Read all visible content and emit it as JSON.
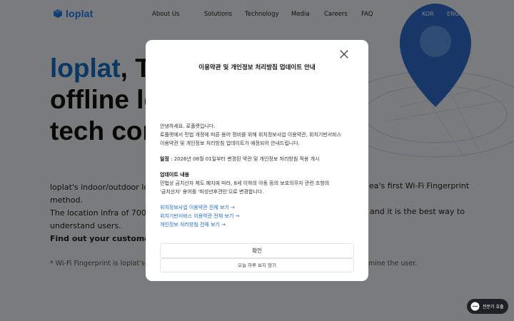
{
  "nav": {
    "logo_text": "loplat",
    "items": [
      "About Us",
      "Solutions",
      "Technology",
      "Media",
      "Careers",
      "FAQ"
    ],
    "lang": [
      "KOR",
      "ENG"
    ]
  },
  "hero": {
    "title_brand": "loplat",
    "title_line1_rest": ", T",
    "title_line2": "offline lo",
    "title_line3": "tech cor",
    "desc_line1_left": "loplat's indoor/outdoor loca",
    "desc_line1_right": "ea's first Wi-Fi Fingerprint",
    "desc_line2": "method.",
    "desc_line3_left": "The location infra of 700K F",
    "desc_line3_right": "and it is the best way to",
    "desc_line4": "understand users.",
    "desc_line5": "Find out your customer's o",
    "note_left": "* Wi-Fi Fingerprint is loplat's locat",
    "note_right": "mine the user."
  },
  "modal": {
    "title": "이용약관 및 개인정보 처리방침 업데이트 안내",
    "greeting": "안녕하세요. 로플랫입니다.",
    "intro_line1": "로플랫에서 민법 개정에 따른 용어 정비를 위해 위치정보사업 이용약관, 위치기반서비스",
    "intro_line2": "이용약관 및 개인정보 처리방침 업데이트가 예정되어 안내드립니다.",
    "schedule_label": "일정",
    "schedule_text": " : 2026년 08월 01일부터 변경된 약관 및 개인정보 처리방침 적용 개시",
    "update_label": "업데이트 내용",
    "update_line1": "민법상 금치산자 제도 폐지에 따라, 8세 이하의 아동 등의 보호의무자 관련 조항의",
    "update_line2": "'금치산자' 용어를 '피성년후견인'으로 변경합니다.",
    "links": [
      "위치정보사업 이용약관 전체 보기 →",
      "위치기반서비스 이용약관 전체 보기 →",
      "개인정보 처리방침 전체 보기 →"
    ],
    "confirm_label": "확인",
    "dismiss_label": "오늘 하루 보지 않기"
  },
  "chat": {
    "label": "전문가 호출"
  },
  "colors": {
    "brand": "#1c7cf4",
    "link": "#1d68d6",
    "overlay": "rgba(0,0,0,0.5)"
  }
}
